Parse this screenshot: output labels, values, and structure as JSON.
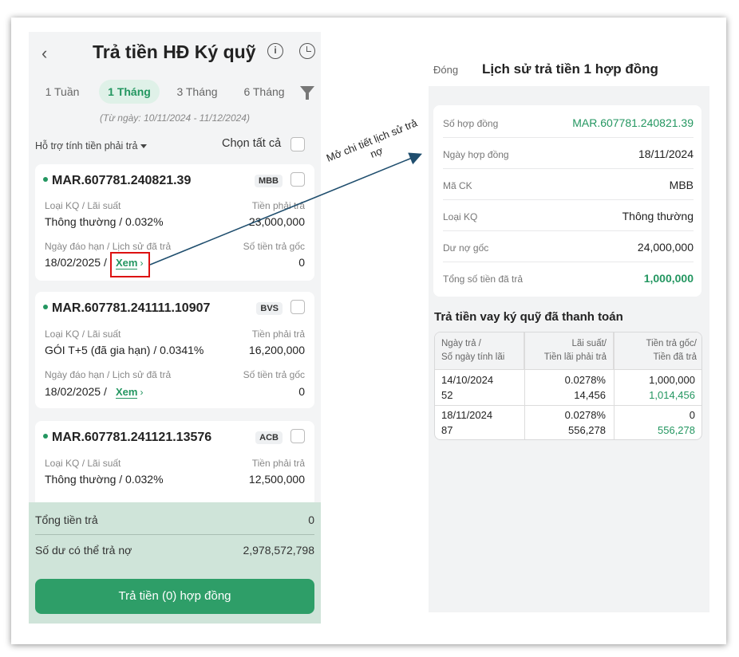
{
  "left": {
    "title": "Trả tiền HĐ Ký quỹ",
    "back_glyph": "‹",
    "tabs": [
      {
        "label": "1 Tuần",
        "active": false
      },
      {
        "label": "1 Tháng",
        "active": true
      },
      {
        "label": "3 Tháng",
        "active": false
      },
      {
        "label": "6 Tháng",
        "active": false
      }
    ],
    "date_range": "(Từ ngày: 10/11/2024 - 11/12/2024)",
    "support_label": "Hỗ trợ tính tiền phải trả",
    "select_all": "Chọn tất cả",
    "cards": [
      {
        "id": "MAR.607781.240821.39",
        "bank": "MBB",
        "type_label": "Loại KQ / Lãi suất",
        "type_value": "Thông thường / 0.032%",
        "pay_label": "Tiền phải trả",
        "pay_value": "23,000,000",
        "due_label": "Ngày đáo hạn / Lịch sử đã trả",
        "due_value": "18/02/2025 /",
        "view_label": "Xem",
        "principal_label": "Số tiền trả gốc",
        "principal_value": "0"
      },
      {
        "id": "MAR.607781.241111.10907",
        "bank": "BVS",
        "type_label": "Loại KQ / Lãi suất",
        "type_value": "GÓI T+5 (đã gia hạn) / 0.0341%",
        "pay_label": "Tiền phải trả",
        "pay_value": "16,200,000",
        "due_label": "Ngày đáo hạn / Lịch sử đã trả",
        "due_value": "18/02/2025 /",
        "view_label": "Xem",
        "principal_label": "Số tiền trả gốc",
        "principal_value": "0"
      },
      {
        "id": "MAR.607781.241121.13576",
        "bank": "ACB",
        "type_label": "Loại KQ / Lãi suất",
        "type_value": "Thông thường / 0.032%",
        "pay_label": "Tiền phải trả",
        "pay_value": "12,500,000"
      }
    ],
    "total_label": "Tổng tiền trả",
    "total_value": "0",
    "balance_label": "Số dư có thể trả nợ",
    "balance_value": "2,978,572,798",
    "pay_button": "Trả tiền (0) hợp đồng"
  },
  "annotation": "Mở chi tiết lịch sử trả nợ",
  "right": {
    "close_label": "Đóng",
    "title": "Lịch sử trả tiền 1 hợp đồng",
    "info": [
      {
        "key": "Số hợp đồng",
        "value": "MAR.607781.240821.39",
        "green": true,
        "bold": false
      },
      {
        "key": "Ngày hợp đồng",
        "value": "18/11/2024",
        "green": false,
        "bold": false
      },
      {
        "key": "Mã CK",
        "value": "MBB",
        "green": false,
        "bold": false
      },
      {
        "key": "Loại KQ",
        "value": "Thông thường",
        "green": false,
        "bold": false
      },
      {
        "key": "Dư nợ gốc",
        "value": "24,000,000",
        "green": false,
        "bold": false
      },
      {
        "key": "Tổng số tiền đã trả",
        "value": "1,000,000",
        "green": true,
        "bold": true
      }
    ],
    "section_title": "Trả tiền vay ký quỹ đã thanh toán",
    "table": {
      "headers": [
        {
          "line1": "Ngày trả /",
          "line2": "Số ngày tính lãi"
        },
        {
          "line1": "Lãi suất/",
          "line2": "Tiền lãi phải trả"
        },
        {
          "line1": "Tiền trả gốc/",
          "line2": "Tiền đã trả"
        }
      ],
      "rows": [
        {
          "date": "14/10/2024",
          "days": "52",
          "rate": "0.0278%",
          "interest": "14,456",
          "principal": "1,000,000",
          "paid": "1,014,456"
        },
        {
          "date": "18/11/2024",
          "days": "87",
          "rate": "0.0278%",
          "interest": "556,278",
          "principal": "0",
          "paid": "556,278"
        }
      ]
    }
  },
  "colors": {
    "accent": "#239660",
    "button": "#2e9e68",
    "highlight_box": "#dd1111",
    "arrow": "#1f4e6e"
  }
}
